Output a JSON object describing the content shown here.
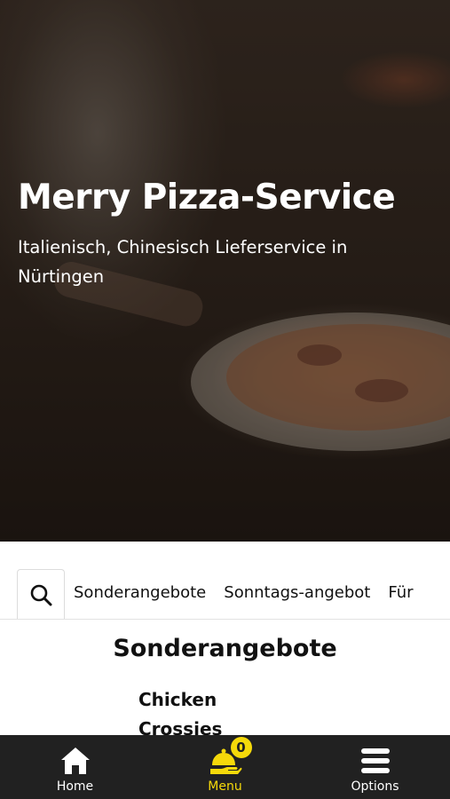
{
  "hero": {
    "title": "Merry Pizza-Service",
    "subtitle": "Italienisch, Chinesisch Lieferservice in Nürtingen"
  },
  "categories": {
    "tabs": [
      "Sonderangebote",
      "Sonntags-angebot",
      "Für"
    ]
  },
  "section": {
    "title": "Sonderangebote",
    "item_name": "Chicken Crossies"
  },
  "bottom_nav": {
    "home_label": "Home",
    "menu_label": "Menu",
    "cart_count": "0",
    "options_label": "Options"
  },
  "colors": {
    "accent": "#f5d90a",
    "nav_background": "#212121",
    "text": "#111111"
  },
  "icons": {
    "search": "search-icon",
    "home": "home-icon",
    "menu": "cloche-icon",
    "options": "hamburger-icon"
  }
}
